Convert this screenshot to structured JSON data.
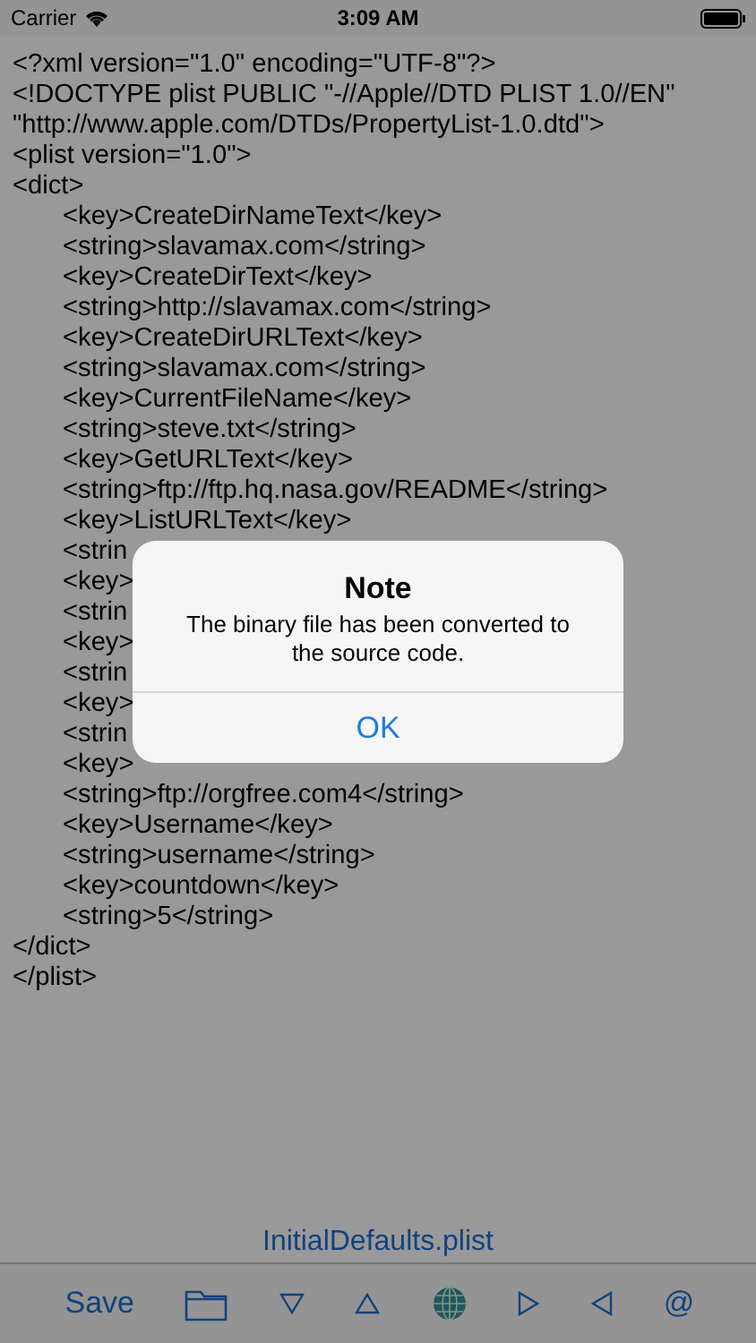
{
  "status_bar": {
    "carrier": "Carrier",
    "time": "3:09 AM"
  },
  "editor": {
    "lines": [
      {
        "text": "<?xml version=\"1.0\" encoding=\"UTF-8\"?>"
      },
      {
        "text": "<!DOCTYPE plist PUBLIC \"-//Apple//DTD PLIST 1.0//EN\""
      },
      {
        "text": "\"http://www.apple.com/DTDs/PropertyList-1.0.dtd\">"
      },
      {
        "text": "<plist version=\"1.0\">"
      },
      {
        "text": "<dict>",
        "children": [
          {
            "text": "<key>CreateDirNameText</key>"
          },
          {
            "text": "<string>slavamax.com</string>"
          },
          {
            "text": "<key>CreateDirText</key>"
          },
          {
            "text": "<string>http://slavamax.com</string>"
          },
          {
            "text": "<key>CreateDirURLText</key>"
          },
          {
            "text": "<string>slavamax.com</string>"
          },
          {
            "text": "<key>CurrentFileName</key>"
          },
          {
            "text": "<string>steve.txt</string>"
          },
          {
            "text": "<key>GetURLText</key>"
          },
          {
            "text": "<string>ftp://ftp.hq.nasa.gov/README</string>"
          },
          {
            "text": "<key>ListURLText</key>"
          },
          {
            "text": "<strin"
          },
          {
            "text": "<key>"
          },
          {
            "text": "<strin"
          },
          {
            "text": "<key>"
          },
          {
            "text": "<strin"
          },
          {
            "text": "<key>"
          },
          {
            "text": "<strin"
          },
          {
            "text": "<key>"
          },
          {
            "text": "<string>ftp://orgfree.com4</string>"
          },
          {
            "text": "<key>Username</key>"
          },
          {
            "text": "<string>username</string>"
          },
          {
            "text": "<key>countdown</key>"
          },
          {
            "text": "<string>5</string>"
          }
        ]
      },
      {
        "text": "</dict>"
      },
      {
        "text": "</plist>"
      }
    ]
  },
  "file_name": "InitialDefaults.plist",
  "toolbar": {
    "save": "Save",
    "at": "@"
  },
  "alert": {
    "title": "Note",
    "message": "The binary file has been converted to the source code.",
    "button": "OK"
  }
}
